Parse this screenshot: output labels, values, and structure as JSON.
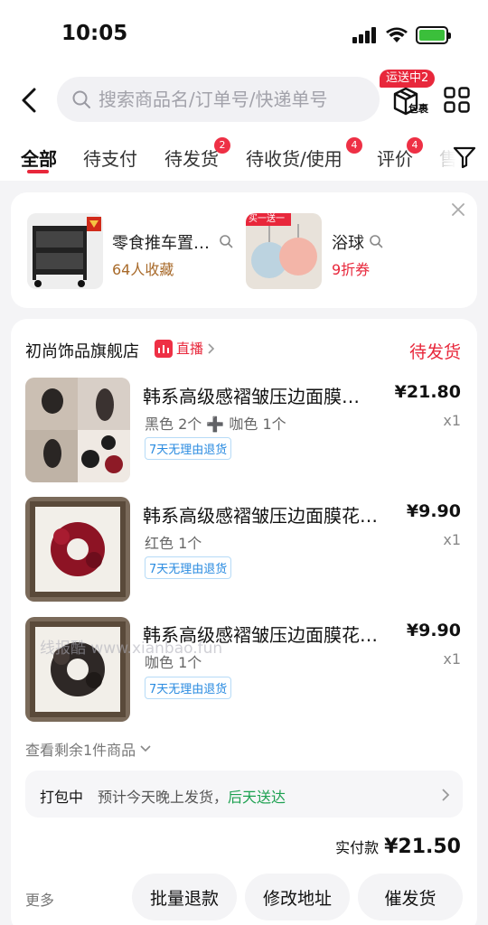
{
  "status_bar": {
    "time": "10:05"
  },
  "header": {
    "search_placeholder": "搜索商品名/订单号/快递单号",
    "package_label": "包裹",
    "package_badge": "运送中2"
  },
  "tabs": [
    {
      "label": "全部",
      "badge": ""
    },
    {
      "label": "待支付",
      "badge": ""
    },
    {
      "label": "待发货",
      "badge": "2"
    },
    {
      "label": "待收货/使用",
      "badge": "4"
    },
    {
      "label": "评价",
      "badge": "4"
    },
    {
      "label": "售",
      "badge": ""
    }
  ],
  "recommendations": [
    {
      "title": "零食推车置…",
      "subtitle": "64人收藏",
      "subtitle_color": "#a86a2a"
    },
    {
      "title": "浴球",
      "subtitle": "9折券",
      "subtitle_color": "#e8273b",
      "image_badge": "买一送一"
    }
  ],
  "order": {
    "shop_name": "初尚饰品旗舰店",
    "live_label": "直播",
    "status": "待发货",
    "items": [
      {
        "title": "韩系高级感褶皱压边面膜…",
        "price": "¥21.80",
        "spec": "黑色 2个 ➕ 咖色 1个",
        "qty": "x1",
        "tag": "7天无理由退货"
      },
      {
        "title": "韩系高级感褶皱压边面膜花…",
        "price": "¥9.90",
        "spec": "红色 1个",
        "qty": "x1",
        "tag": "7天无理由退货"
      },
      {
        "title": "韩系高级感褶皱压边面膜花…",
        "price": "¥9.90",
        "spec": "咖色 1个",
        "qty": "x1",
        "tag": "7天无理由退货"
      }
    ],
    "more_items": "查看剩余1件商品",
    "pack_label": "打包中",
    "pack_text": "预计今天晚上发货，",
    "pack_highlight": "后天送达",
    "paid_label": "实付款",
    "paid_amount": "¥21.50",
    "more_link": "更多",
    "buttons": [
      "批量退款",
      "修改地址",
      "催发货"
    ]
  },
  "watermark": "线报酷 www.xianbao.fun",
  "colors": {
    "accent": "#e8273b",
    "green": "#1ea151",
    "tag_blue": "#2a8be0"
  }
}
